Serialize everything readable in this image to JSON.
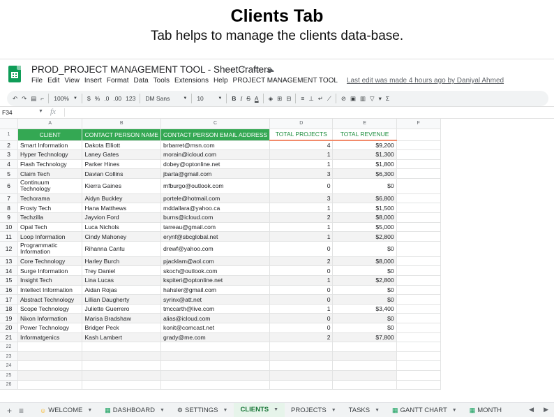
{
  "banner": {
    "title": "Clients Tab",
    "subtitle": "Tab helps to manage the clients data-base."
  },
  "app": {
    "doc_title": "PROD_PROJECT MANAGEMENT TOOL - SheetCrafters",
    "menus": [
      "File",
      "Edit",
      "View",
      "Insert",
      "Format",
      "Data",
      "Tools",
      "Extensions",
      "Help",
      "PROJECT MANAGEMENT TOOL"
    ],
    "last_edit": "Last edit was made 4 hours ago by Daniyal Ahmed"
  },
  "toolbar": {
    "zoom": "100%",
    "currency": "$",
    "percent": "%",
    "dec_less": ".0",
    "dec_more": ".00",
    "format_more": "123",
    "font": "DM Sans",
    "font_size": "10",
    "bold": "B",
    "italic": "I",
    "strike": "S",
    "text_color": "A",
    "sum": "Σ"
  },
  "formula_bar": {
    "cell_ref": "F34",
    "fx": "fx"
  },
  "grid": {
    "columns": [
      "A",
      "B",
      "C",
      "D",
      "E",
      "F"
    ],
    "headers": [
      "CLIENT",
      "CONTACT PERSON NAME",
      "CONTACT PERSON EMAIL ADDRESS",
      "TOTAL PROJECTS",
      "TOTAL REVENUE"
    ],
    "rows": [
      {
        "n": "2",
        "client": "Smart Information",
        "contact": "Dakota Elliott",
        "email": "brbarret@msn.com",
        "projects": "4",
        "revenue": "$9,200"
      },
      {
        "n": "3",
        "client": "Hyper Technology",
        "contact": "Laney Gates",
        "email": "morain@icloud.com",
        "projects": "1",
        "revenue": "$1,300"
      },
      {
        "n": "4",
        "client": "Flash Technology",
        "contact": "Parker Hines",
        "email": "dobey@optonline.net",
        "projects": "1",
        "revenue": "$1,800"
      },
      {
        "n": "5",
        "client": "Claim Tech",
        "contact": "Davian Collins",
        "email": "jbarta@gmail.com",
        "projects": "3",
        "revenue": "$6,300"
      },
      {
        "n": "6",
        "client": "Continuum Technology",
        "contact": "Kierra Gaines",
        "email": "mfburgo@outlook.com",
        "projects": "0",
        "revenue": "$0",
        "tall": true
      },
      {
        "n": "7",
        "client": "Techorama",
        "contact": "Aidyn Buckley",
        "email": "portele@hotmail.com",
        "projects": "3",
        "revenue": "$6,800"
      },
      {
        "n": "8",
        "client": "Frosty Tech",
        "contact": "Hana Matthews",
        "email": "mddallara@yahoo.ca",
        "projects": "1",
        "revenue": "$1,500"
      },
      {
        "n": "9",
        "client": "Techzilla",
        "contact": "Jayvion Ford",
        "email": "burns@icloud.com",
        "projects": "2",
        "revenue": "$8,000"
      },
      {
        "n": "10",
        "client": "Opal Tech",
        "contact": "Luca Nichols",
        "email": "tarreau@gmail.com",
        "projects": "1",
        "revenue": "$5,000"
      },
      {
        "n": "11",
        "client": "Loop Information",
        "contact": "Cindy Mahoney",
        "email": "erynf@sbcglobal.net",
        "projects": "1",
        "revenue": "$2,800"
      },
      {
        "n": "12",
        "client": "Programmatic Information",
        "contact": "Rihanna Cantu",
        "email": "drewf@yahoo.com",
        "projects": "0",
        "revenue": "$0",
        "tall": true
      },
      {
        "n": "13",
        "client": "Core Technology",
        "contact": "Harley Burch",
        "email": "pjacklam@aol.com",
        "projects": "2",
        "revenue": "$8,000"
      },
      {
        "n": "14",
        "client": "Surge Information",
        "contact": "Trey Daniel",
        "email": "skoch@outlook.com",
        "projects": "0",
        "revenue": "$0"
      },
      {
        "n": "15",
        "client": "Insight Tech",
        "contact": "Lina Lucas",
        "email": "kspiteri@optonline.net",
        "projects": "1",
        "revenue": "$2,800"
      },
      {
        "n": "16",
        "client": "Intellect Information",
        "contact": "Aidan Rojas",
        "email": "hahsler@gmail.com",
        "projects": "0",
        "revenue": "$0"
      },
      {
        "n": "17",
        "client": "Abstract Technology",
        "contact": "Lillian Daugherty",
        "email": "syrinx@att.net",
        "projects": "0",
        "revenue": "$0"
      },
      {
        "n": "18",
        "client": "Scope Technology",
        "contact": "Juliette Guerrero",
        "email": "tmccarth@live.com",
        "projects": "1",
        "revenue": "$3,400"
      },
      {
        "n": "19",
        "client": "Nixon Information",
        "contact": "Marisa Bradshaw",
        "email": "alias@icloud.com",
        "projects": "0",
        "revenue": "$0"
      },
      {
        "n": "20",
        "client": "Power Technology",
        "contact": "Bridger Peck",
        "email": "konit@comcast.net",
        "projects": "0",
        "revenue": "$0"
      },
      {
        "n": "21",
        "client": "Informatgenics",
        "contact": "Kash Lambert",
        "email": "grady@me.com",
        "projects": "2",
        "revenue": "$7,800"
      }
    ],
    "empty_rows": [
      "22",
      "23",
      "24",
      "25",
      "26"
    ]
  },
  "tabs": {
    "items": [
      {
        "label": "WELCOME",
        "icon": "face-icon"
      },
      {
        "label": "DASHBOARD",
        "icon": "chart-icon"
      },
      {
        "label": "SETTINGS",
        "icon": "gear-icon"
      },
      {
        "label": "CLIENTS",
        "icon": "",
        "active": true
      },
      {
        "label": "PROJECTS",
        "icon": ""
      },
      {
        "label": "TASKS",
        "icon": ""
      },
      {
        "label": "GANTT CHART",
        "icon": "chart-icon"
      },
      {
        "label": "MONTH",
        "icon": "chart-icon"
      }
    ]
  },
  "colors": {
    "header_green": "#34a853",
    "accent_green": "#1e8e3e",
    "accent_underline": "#f28b6b",
    "alt_row": "#f3f3f3"
  }
}
